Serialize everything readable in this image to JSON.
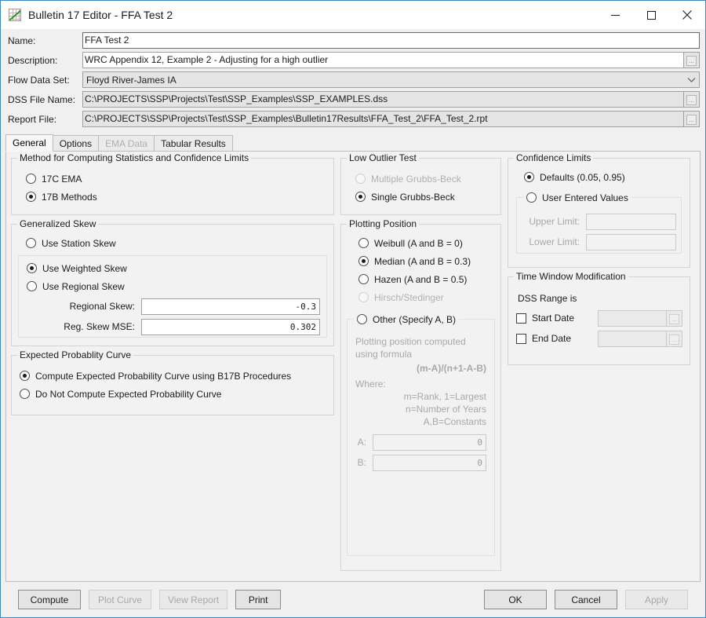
{
  "window": {
    "title": "Bulletin 17 Editor - FFA Test 2",
    "icon": "chart-icon",
    "minimize": "minimize-icon",
    "maximize": "maximize-icon",
    "close": "close-icon",
    "accent_color": "#3b8ac4"
  },
  "header": {
    "fields": [
      {
        "label": "Name:",
        "value": "FFA Test 2",
        "type": "text"
      },
      {
        "label": "Description:",
        "value": "WRC Appendix 12, Example 2 - Adjusting for a high outlier",
        "type": "text-browse"
      },
      {
        "label": "Flow Data Set:",
        "value": "Floyd River-James IA",
        "type": "combo"
      },
      {
        "label": "DSS File Name:",
        "value": "C:\\PROJECTS\\SSP\\Projects\\Test\\SSP_Examples\\SSP_EXAMPLES.dss",
        "type": "text-browse"
      },
      {
        "label": "Report File:",
        "value": "C:\\PROJECTS\\SSP\\Projects\\Test\\SSP_Examples\\Bulletin17Results\\FFA_Test_2\\FFA_Test_2.rpt",
        "type": "text-browse"
      }
    ],
    "browse_label": "..."
  },
  "tabs": [
    {
      "label": "General",
      "selected": true,
      "disabled": false
    },
    {
      "label": "Options",
      "selected": false,
      "disabled": false
    },
    {
      "label": "EMA Data",
      "selected": false,
      "disabled": true
    },
    {
      "label": "Tabular Results",
      "selected": false,
      "disabled": false
    }
  ],
  "method_group": {
    "title": "Method for Computing Statistics and Confidence Limits",
    "options": [
      {
        "label": "17C EMA",
        "checked": false
      },
      {
        "label": "17B Methods",
        "checked": true
      }
    ]
  },
  "skew_group": {
    "title": "Generalized Skew",
    "station_option": {
      "label": "Use Station Skew",
      "checked": false
    },
    "options": [
      {
        "label": "Use Weighted Skew",
        "checked": true
      },
      {
        "label": "Use Regional Skew",
        "checked": false
      }
    ],
    "fields": [
      {
        "label": "Regional Skew:",
        "value": "-0.3"
      },
      {
        "label": "Reg. Skew MSE:",
        "value": "0.302"
      }
    ]
  },
  "epc_group": {
    "title": "Expected Probablity Curve",
    "options": [
      {
        "label": "Compute Expected Probability Curve using B17B Procedures",
        "checked": true
      },
      {
        "label": "Do Not Compute Expected Probability Curve",
        "checked": false
      }
    ]
  },
  "low_outlier_group": {
    "title": "Low Outlier Test",
    "options": [
      {
        "label": "Multiple Grubbs-Beck",
        "checked": false,
        "disabled": true
      },
      {
        "label": "Single Grubbs-Beck",
        "checked": true,
        "disabled": false
      }
    ]
  },
  "plotting_group": {
    "title": "Plotting Position",
    "options": [
      {
        "label": "Weibull (A and B = 0)",
        "checked": false,
        "disabled": false
      },
      {
        "label": "Median (A and B = 0.3)",
        "checked": true,
        "disabled": false
      },
      {
        "label": "Hazen (A and B = 0.5)",
        "checked": false,
        "disabled": false
      },
      {
        "label": "Hirsch/Stedinger",
        "checked": false,
        "disabled": true
      }
    ],
    "other": {
      "label": "Other (Specify A, B)",
      "checked": false,
      "help_line1": "Plotting position computed using formula",
      "formula": "(m-A)/(n+1-A-B)",
      "where_label": "Where:",
      "where_lines": [
        "m=Rank, 1=Largest",
        "n=Number of Years",
        "A,B=Constants"
      ],
      "fields": [
        {
          "label": "A:",
          "value": "0"
        },
        {
          "label": "B:",
          "value": "0"
        }
      ]
    }
  },
  "confidence_group": {
    "title": "Confidence Limits",
    "defaults_option": {
      "label": "Defaults (0.05, 0.95)",
      "checked": true
    },
    "user_option": {
      "label": "User Entered Values",
      "checked": false
    },
    "fields": [
      {
        "label": "Upper Limit:",
        "value": ""
      },
      {
        "label": "Lower Limit:",
        "value": ""
      }
    ]
  },
  "time_window_group": {
    "title": "Time Window Modification",
    "subtitle": "DSS Range is",
    "rows": [
      {
        "label": "Start Date",
        "checked": false,
        "value": ""
      },
      {
        "label": "End Date",
        "checked": false,
        "value": ""
      }
    ],
    "browse_label": "..."
  },
  "footer": {
    "left_buttons": [
      {
        "label": "Compute",
        "disabled": false
      },
      {
        "label": "Plot Curve",
        "disabled": true
      },
      {
        "label": "View Report",
        "disabled": true
      },
      {
        "label": "Print",
        "disabled": false
      }
    ],
    "right_buttons": [
      {
        "label": "OK",
        "disabled": false
      },
      {
        "label": "Cancel",
        "disabled": false
      },
      {
        "label": "Apply",
        "disabled": true
      }
    ]
  }
}
